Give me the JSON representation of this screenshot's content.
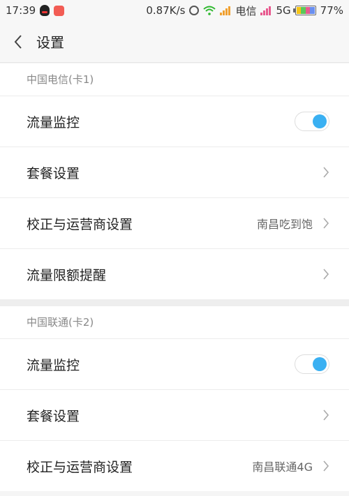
{
  "status_bar": {
    "time": "17:39",
    "speed": "0.87K/s",
    "carrier": "电信",
    "network": "5G",
    "battery": "77%"
  },
  "header": {
    "title": "设置"
  },
  "sections": [
    {
      "label": "中国电信(卡1)",
      "rows": [
        {
          "label": "流量监控",
          "type": "toggle",
          "on": true
        },
        {
          "label": "套餐设置",
          "type": "chevron"
        },
        {
          "label": "校正与运营商设置",
          "type": "chevron",
          "value": "南昌吃到饱"
        },
        {
          "label": "流量限额提醒",
          "type": "chevron"
        }
      ]
    },
    {
      "label": "中国联通(卡2)",
      "rows": [
        {
          "label": "流量监控",
          "type": "toggle",
          "on": true
        },
        {
          "label": "套餐设置",
          "type": "chevron"
        },
        {
          "label": "校正与运营商设置",
          "type": "chevron",
          "value": "南昌联通4G"
        }
      ]
    }
  ],
  "colors": {
    "toggle_on": "#3ab0f2",
    "background": "#f5f5f5"
  }
}
